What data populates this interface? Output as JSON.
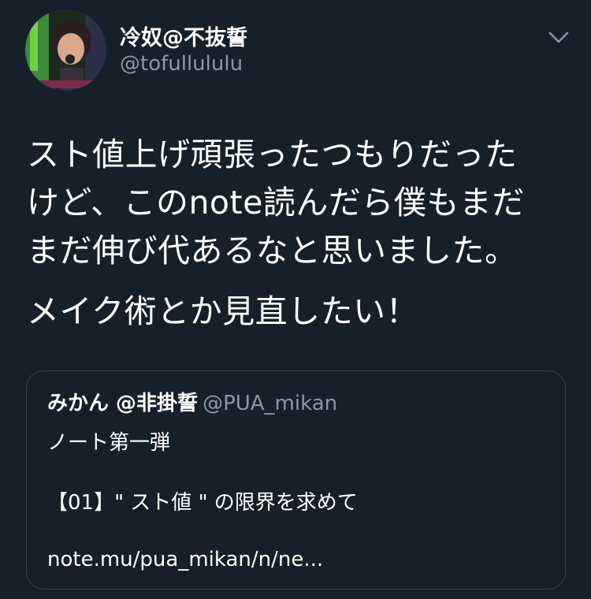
{
  "tweet": {
    "display_name": "冷奴@不抜誓",
    "handle": "@tofullululu",
    "avatar_icon": "user-avatar-photo",
    "menu_icon": "chevron-down-icon",
    "body_lines": [
      "スト値上げ頑張ったつもりだった",
      "けど、このnote読んだら僕もまだ",
      "まだ伸び代あるなと思いました。",
      "メイク術とか見直したい！"
    ]
  },
  "quoted_tweet": {
    "display_name": "みかん @非掛誓",
    "handle": "@PUA_mikan",
    "line1": "ノート第一弾",
    "line2": "【01】\" スト値 \" の限界を求めて",
    "line3": "note.mu/pua_mikan/n/ne..."
  },
  "colors": {
    "background": "#15202b",
    "secondary_text": "#8899a6",
    "border": "#38444d"
  }
}
